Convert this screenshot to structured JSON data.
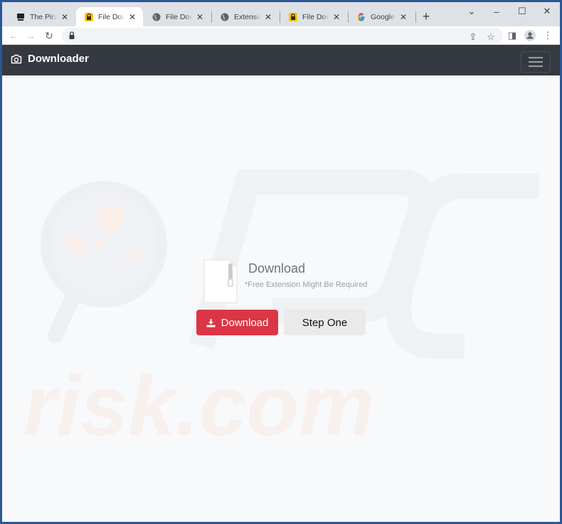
{
  "browser": {
    "tabs": [
      {
        "title": "The Pirate B",
        "favicon": "pirate-ship-icon",
        "active": false
      },
      {
        "title": "File Downlo",
        "favicon": "yellow-lock-icon",
        "active": true
      },
      {
        "title": "File Downlo",
        "favicon": "globe-icon",
        "active": false
      },
      {
        "title": "Extension",
        "favicon": "globe-icon",
        "active": false
      },
      {
        "title": "File Downlo",
        "favicon": "yellow-lock-icon",
        "active": false
      },
      {
        "title": "Google",
        "favicon": "google-icon",
        "active": false
      }
    ],
    "close_glyph": "✕",
    "new_tab_glyph": "+",
    "address": "",
    "window_controls": {
      "tab_search": "⌄",
      "minimize": "–",
      "maximize": "☐",
      "close": "✕"
    },
    "nav": {
      "back": "←",
      "forward": "→",
      "reload": "↻"
    },
    "toolbar_icons": {
      "share": "⇪",
      "bookmark": "☆",
      "sidepanel": "◨",
      "menu": "⋮"
    }
  },
  "page": {
    "brand": "Downloader",
    "brand_icon": "camera-icon",
    "download": {
      "title": "Download",
      "subtitle": "*Free Extension Might Be Required"
    },
    "buttons": {
      "download_label": "Download",
      "step_one_label": "Step One"
    },
    "colors": {
      "navbar": "#343a40",
      "download_button": "#dc3545",
      "step_button": "#eaeaea",
      "page_bg": "#f8f9fa"
    },
    "watermark_text": "risk.com"
  }
}
